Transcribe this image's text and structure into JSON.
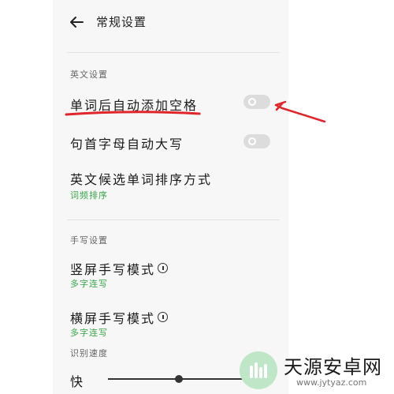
{
  "header": {
    "title": "常规设置",
    "back_icon": "arrow-left-icon"
  },
  "english_section": {
    "heading": "英文设置",
    "items": [
      {
        "label": "单词后自动添加空格",
        "toggle": false
      },
      {
        "label": "句首字母自动大写",
        "toggle": false
      },
      {
        "label": "英文候选单词排序方式",
        "value": "词频排序"
      }
    ]
  },
  "handwriting_section": {
    "heading": "手写设置",
    "items": [
      {
        "label": "竖屏手写模式",
        "value": "多字连写",
        "icon": "info-icon"
      },
      {
        "label": "横屏手写模式",
        "value": "多字连写",
        "icon": "info-icon"
      }
    ],
    "speed": {
      "heading": "识别速度",
      "label_fast": "快",
      "level": 0.45
    }
  },
  "annotation": {
    "underline_color": "#e0252b",
    "arrow_color": "#e0252b"
  },
  "watermark": {
    "name": "天源安卓网",
    "url": "www.jytyaz.com"
  },
  "colors": {
    "accent_green": "#3aa64c",
    "panel_bg": "#f7f7f7",
    "toggle_off": "#dcdcdc"
  }
}
